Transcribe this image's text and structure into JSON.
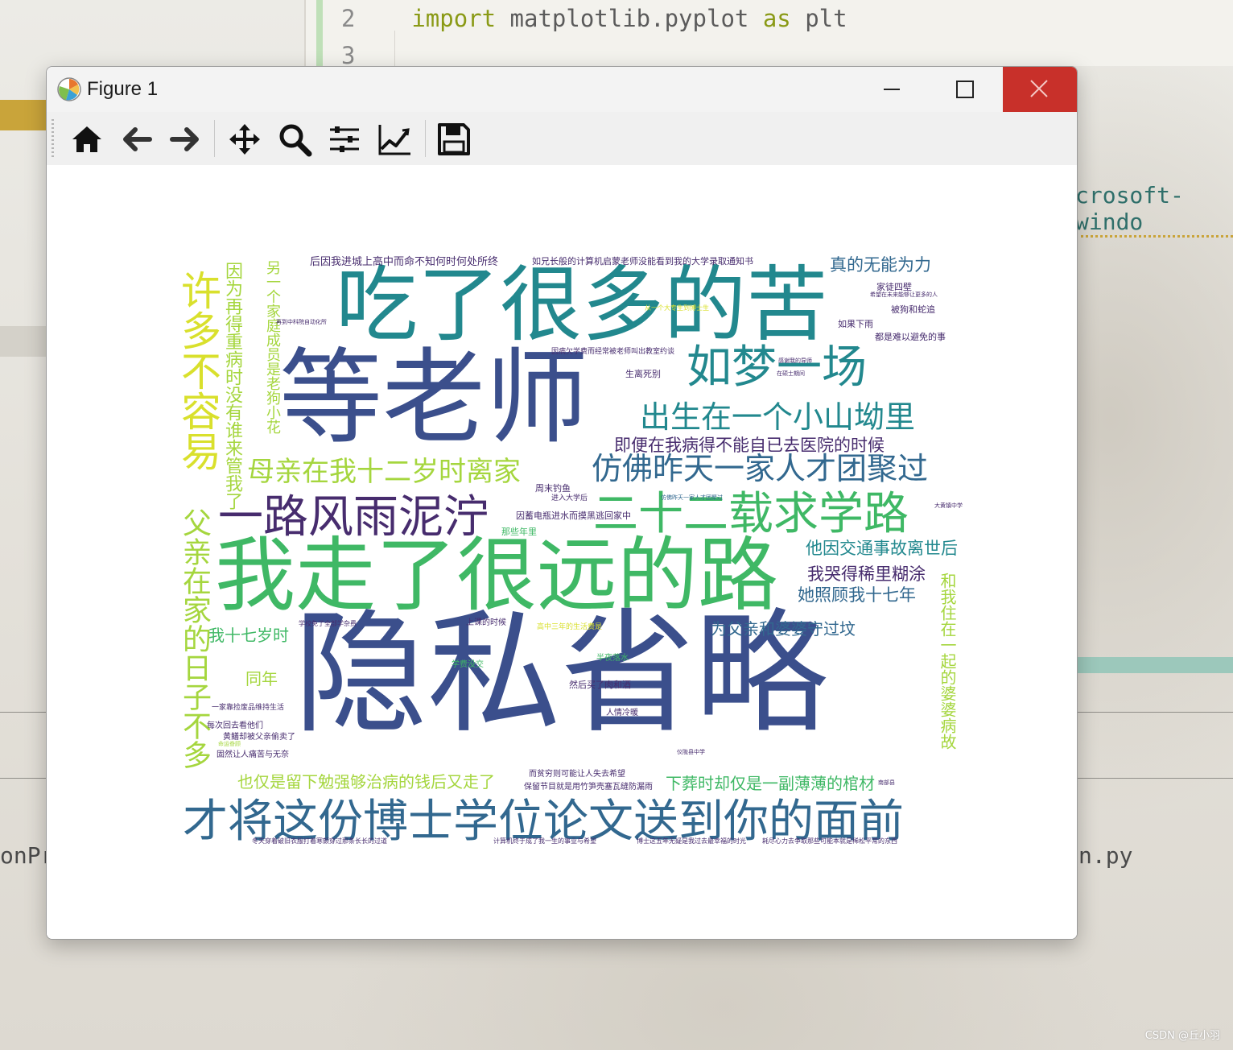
{
  "background": {
    "code_lines": [
      {
        "num": "2",
        "keyword1": "import",
        "module": "matplotlib.pyplot",
        "keyword2": "as",
        "alias": "plt"
      },
      {
        "num": "3"
      }
    ],
    "side_text_top": "crosoft-windo",
    "side_text_left": "onPr",
    "side_text_right": "n.py",
    "watermark": "CSDN @丘小羽"
  },
  "window": {
    "title": "Figure 1",
    "controls": {
      "minimize": "minimize-icon",
      "maximize": "maximize-icon",
      "close": "close-icon"
    },
    "toolbar": [
      "home-icon",
      "back-icon",
      "forward-icon",
      "pan-icon",
      "zoom-icon",
      "subplots-icon",
      "customize-icon",
      "save-icon"
    ]
  },
  "wordcloud": {
    "colors": {
      "navy": "#3b4f8c",
      "teal": "#22888e",
      "green": "#3fb865",
      "lime": "#a5d63e",
      "yellow": "#d9e02c",
      "purple": "#472c6e",
      "blue": "#32688f"
    },
    "words": [
      {
        "text": "隐私省略",
        "color": "#3b4f8c"
      },
      {
        "text": "等老师",
        "color": "#3b4f8c"
      },
      {
        "text": "吃了很多的苦",
        "color": "#22888e"
      },
      {
        "text": "我走了很远的路",
        "color": "#3fb865"
      },
      {
        "text": "才将这份博士学位论文送到你的面前",
        "color": "#32688f"
      },
      {
        "text": "一路风雨泥泞",
        "color": "#472c6e"
      },
      {
        "text": "二十二载求学路",
        "color": "#3fb865"
      },
      {
        "text": "如梦一场",
        "color": "#22888e"
      },
      {
        "text": "出生在一个小山坳里",
        "color": "#22888e"
      },
      {
        "text": "仿佛昨天一家人才团聚过",
        "color": "#32688f"
      },
      {
        "text": "母亲在我十二岁时离家",
        "color": "#a5d63e"
      },
      {
        "text": "许多不容易",
        "color": "#d9e02c"
      },
      {
        "text": "父亲在家的日子不多",
        "color": "#a5d63e"
      },
      {
        "text": "因为再得重病时没有谁来管我了",
        "color": "#a5d63e"
      },
      {
        "text": "另一个家庭成员是老狗小花",
        "color": "#a5d63e"
      },
      {
        "text": "真的无能为力",
        "color": "#32688f"
      },
      {
        "text": "即便在我病得不能自已去医院的时候",
        "color": "#472c6e"
      },
      {
        "text": "他因交通事故离世后",
        "color": "#22888e"
      },
      {
        "text": "我哭得稀里糊涂",
        "color": "#472c6e"
      },
      {
        "text": "她照顾我十七年",
        "color": "#32688f"
      },
      {
        "text": "为父亲和婆婆守过坟",
        "color": "#32688f"
      },
      {
        "text": "我十七岁时",
        "color": "#3fb865"
      },
      {
        "text": "同年",
        "color": "#a5d63e"
      },
      {
        "text": "和我住在一起的婆婆病故",
        "color": "#a5d63e"
      },
      {
        "text": "也仅是留下勉强够治病的钱后又走了",
        "color": "#a5d63e"
      },
      {
        "text": "下葬时却仅是一副薄薄的棺材",
        "color": "#3fb865"
      },
      {
        "text": "后因我进城上高中而命不知何时何处所终",
        "color": "#472c6e"
      },
      {
        "text": "如兄长般的计算机启蒙老师没能看到我的大学录取通知书",
        "color": "#472c6e"
      },
      {
        "text": "家徒四壁",
        "color": "#472c6e"
      },
      {
        "text": "被狗和蛇追",
        "color": "#472c6e"
      },
      {
        "text": "如果下雨",
        "color": "#472c6e"
      },
      {
        "text": "都是难以避免的事",
        "color": "#472c6e"
      },
      {
        "text": "生离死别",
        "color": "#472c6e"
      },
      {
        "text": "周末钓鱼",
        "color": "#472c6e"
      },
      {
        "text": "进入大学后",
        "color": "#472c6e"
      },
      {
        "text": "因蓄电瓶进水而摸黑逃回家中",
        "color": "#472c6e"
      },
      {
        "text": "那些年里",
        "color": "#3fb865"
      },
      {
        "text": "上课的时候",
        "color": "#472c6e"
      },
      {
        "text": "学费没交",
        "color": "#3fb865"
      },
      {
        "text": "半夜落水",
        "color": "#3fb865"
      },
      {
        "text": "然后买了肉和酒",
        "color": "#472c6e"
      },
      {
        "text": "人情冷暖",
        "color": "#472c6e"
      },
      {
        "text": "每次回去看他们",
        "color": "#472c6e"
      },
      {
        "text": "黄鳝却被父亲偷卖了",
        "color": "#472c6e"
      },
      {
        "text": "固然让人痛苦与无奈",
        "color": "#472c6e"
      },
      {
        "text": "而贫穷则可能让人失去希望",
        "color": "#472c6e"
      },
      {
        "text": "保留节目就是用竹笋壳塞瓦缝防漏雨",
        "color": "#472c6e"
      },
      {
        "text": "冬天穿着破旧衣服打着寒颤穿过那条长长的过道",
        "color": "#472c6e"
      },
      {
        "text": "计算机终于成了我一生的事业与希望",
        "color": "#472c6e"
      },
      {
        "text": "博士这五年无疑是我过去最幸福的时光",
        "color": "#472c6e"
      },
      {
        "text": "耗尽心力去争取那些可能本就是稀松平常的东西",
        "color": "#472c6e"
      },
      {
        "text": "仿佛昨天一家人才团聚过",
        "color": "#32688f"
      },
      {
        "text": "一家靠捡废品维持生活",
        "color": "#472c6e"
      },
      {
        "text": "因病欠学费而经常被老师叫出教室约谈",
        "color": "#472c6e"
      },
      {
        "text": "从一个大专生到博士生",
        "color": "#d9e02c"
      },
      {
        "text": "学校免了全部学杂费",
        "color": "#472c6e"
      },
      {
        "text": "高中三年的生活费是",
        "color": "#d9e02c"
      },
      {
        "text": "命运眷顾",
        "color": "#a5d63e"
      },
      {
        "text": "再到中科院自动化所",
        "color": "#472c6e"
      },
      {
        "text": "希望在未来能够让更多的人",
        "color": "#472c6e"
      },
      {
        "text": "感谢我的导师",
        "color": "#472c6e"
      },
      {
        "text": "在硕士期间",
        "color": "#472c6e"
      },
      {
        "text": "大黄镇中学",
        "color": "#472c6e"
      },
      {
        "text": "仪陇县中学",
        "color": "#472c6e"
      },
      {
        "text": "南部县",
        "color": "#472c6e"
      }
    ]
  }
}
